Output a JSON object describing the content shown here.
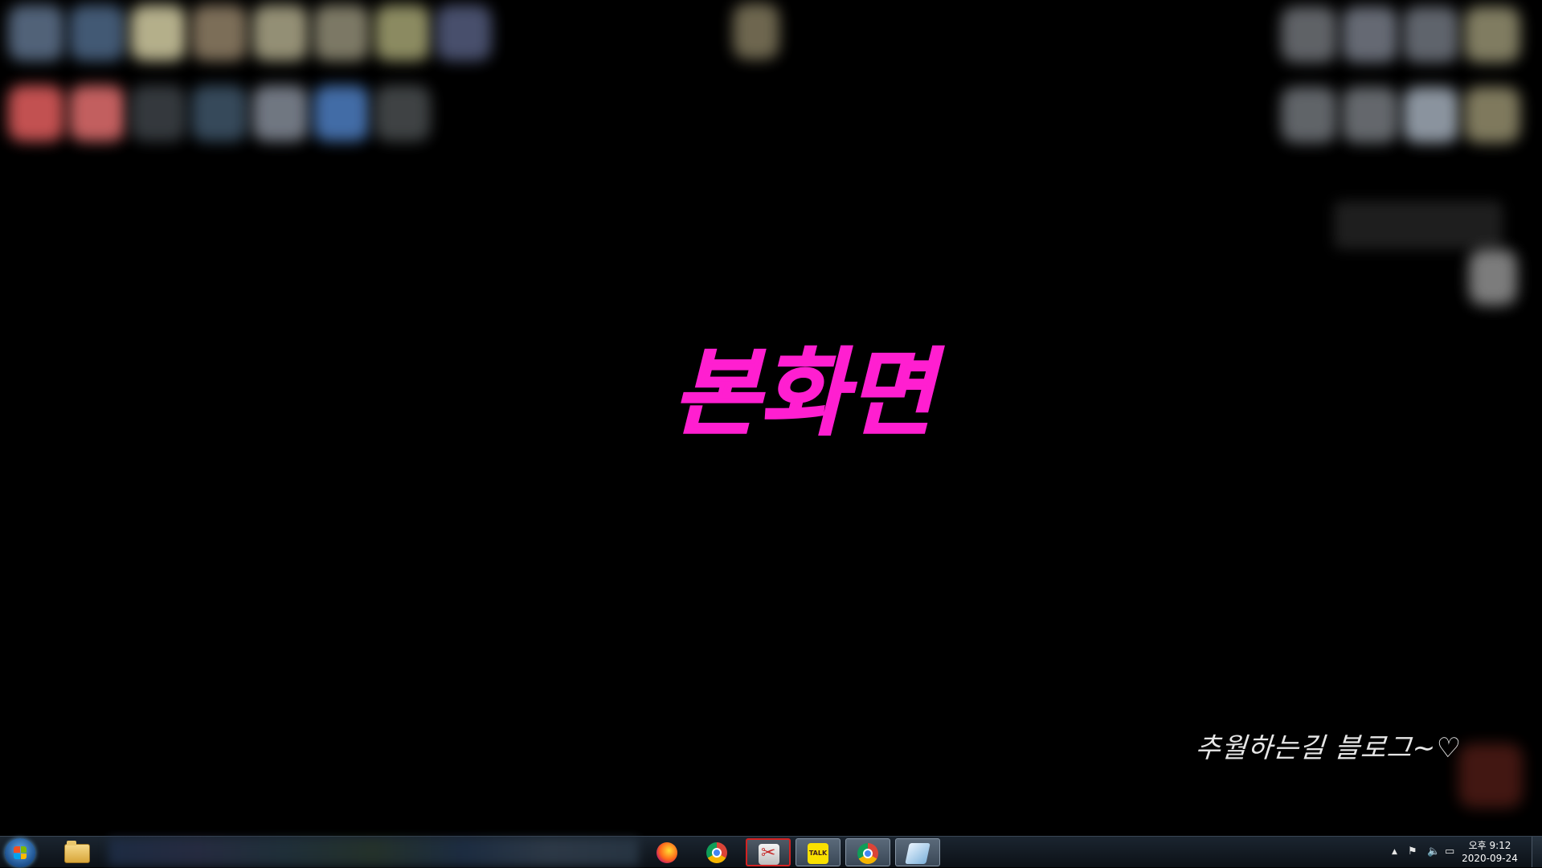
{
  "desktop": {
    "handwritten_label": "본화면",
    "handwritten_color": "#ff1fd0",
    "signature": "추월하는길 블로그~♡"
  },
  "taskbar": {
    "start_icon": "windows-start-orb",
    "pinned": [
      {
        "id": "explorer",
        "icon": "folder-icon"
      },
      {
        "id": "firefox",
        "icon": "firefox-icon"
      },
      {
        "id": "chrome",
        "icon": "chrome-icon"
      },
      {
        "id": "snipping-tool",
        "icon": "scissors-icon"
      },
      {
        "id": "kakaotalk",
        "icon": "talk-icon",
        "label": "TALK"
      },
      {
        "id": "chrome-user",
        "icon": "chrome-icon"
      },
      {
        "id": "sheet-app",
        "icon": "sheet-icon"
      }
    ],
    "tray": {
      "icons": [
        "show-hidden-icons-icon",
        "action-center-flag-icon",
        "volume-icon",
        "network-icon"
      ],
      "show_hidden_glyph": "▲",
      "flag_glyph": "⚑",
      "volume_glyph": "🔈",
      "network_glyph": "▭"
    },
    "clock": {
      "time": "오후 9:12",
      "date": "2020-09-24"
    }
  }
}
